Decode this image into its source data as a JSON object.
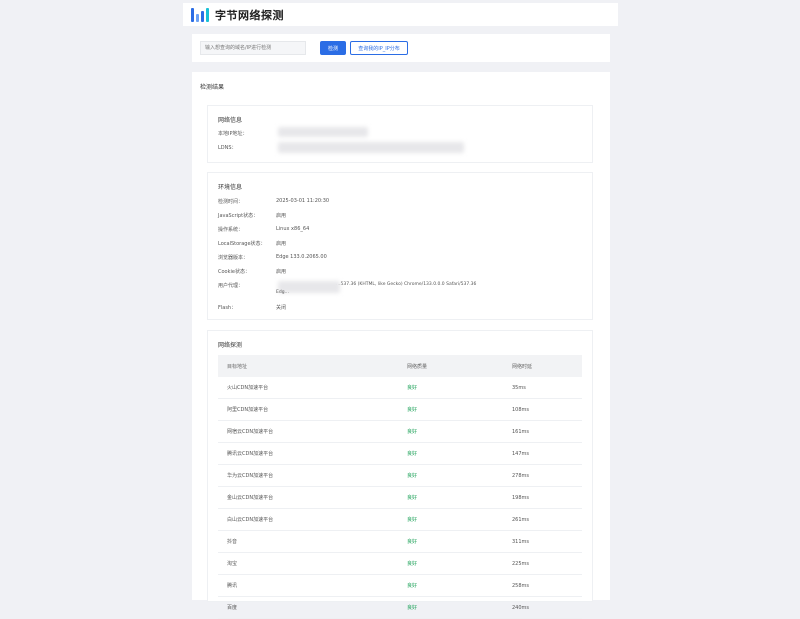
{
  "header": {
    "brand": "字节网络探测",
    "logo_colors": [
      "#2b6de5",
      "#6aa1f5",
      "#2b6de5",
      "#19c0d6"
    ]
  },
  "search": {
    "placeholder": "输入想查询的域名/IP进行检测",
    "search_label": "检测",
    "myip_label": "查询我的IP_IP分布"
  },
  "main": {
    "title": "检测结果"
  },
  "basic": {
    "title": "网络信息",
    "rows": [
      {
        "key": "本地IP地址："
      },
      {
        "key": "LDNS："
      }
    ]
  },
  "browser": {
    "title": "环境信息",
    "rows": [
      {
        "key": "检测时间：",
        "value": "2025-03-01 11:20:30"
      },
      {
        "key": "JavaScript状态：",
        "value": "启用"
      },
      {
        "key": "操作系统：",
        "value": "Linux x86_64"
      },
      {
        "key": "LocalStorage状态：",
        "value": "启用"
      },
      {
        "key": "浏览器版本：",
        "value": "Edge 133.0.2065.00"
      },
      {
        "key": "Cookie状态：",
        "value": "启用"
      },
      {
        "key": "用户代理：",
        "value": "…537.36 (KHTML, like Gecko) Chrome/133.0.0.0 Safari/537.36",
        "value2": "Edg…"
      },
      {
        "key": "Flash：",
        "value": "关闭"
      }
    ]
  },
  "probe": {
    "title": "网络探测",
    "columns": [
      "目标地址",
      "网络质量",
      "网络时延"
    ],
    "rows": [
      {
        "target": "火山CDN加速平台",
        "quality": "良好",
        "latency": "35ms"
      },
      {
        "target": "阿里CDN加速平台",
        "quality": "良好",
        "latency": "108ms"
      },
      {
        "target": "网宿云CDN加速平台",
        "quality": "良好",
        "latency": "161ms"
      },
      {
        "target": "腾讯云CDN加速平台",
        "quality": "良好",
        "latency": "147ms"
      },
      {
        "target": "华为云CDN加速平台",
        "quality": "良好",
        "latency": "278ms"
      },
      {
        "target": "金山云CDN加速平台",
        "quality": "良好",
        "latency": "198ms"
      },
      {
        "target": "白山云CDN加速平台",
        "quality": "良好",
        "latency": "261ms"
      },
      {
        "target": "抖音",
        "quality": "良好",
        "latency": "311ms"
      },
      {
        "target": "淘宝",
        "quality": "良好",
        "latency": "225ms"
      },
      {
        "target": "腾讯",
        "quality": "良好",
        "latency": "258ms"
      },
      {
        "target": "百度",
        "quality": "良好",
        "latency": "240ms"
      }
    ]
  }
}
